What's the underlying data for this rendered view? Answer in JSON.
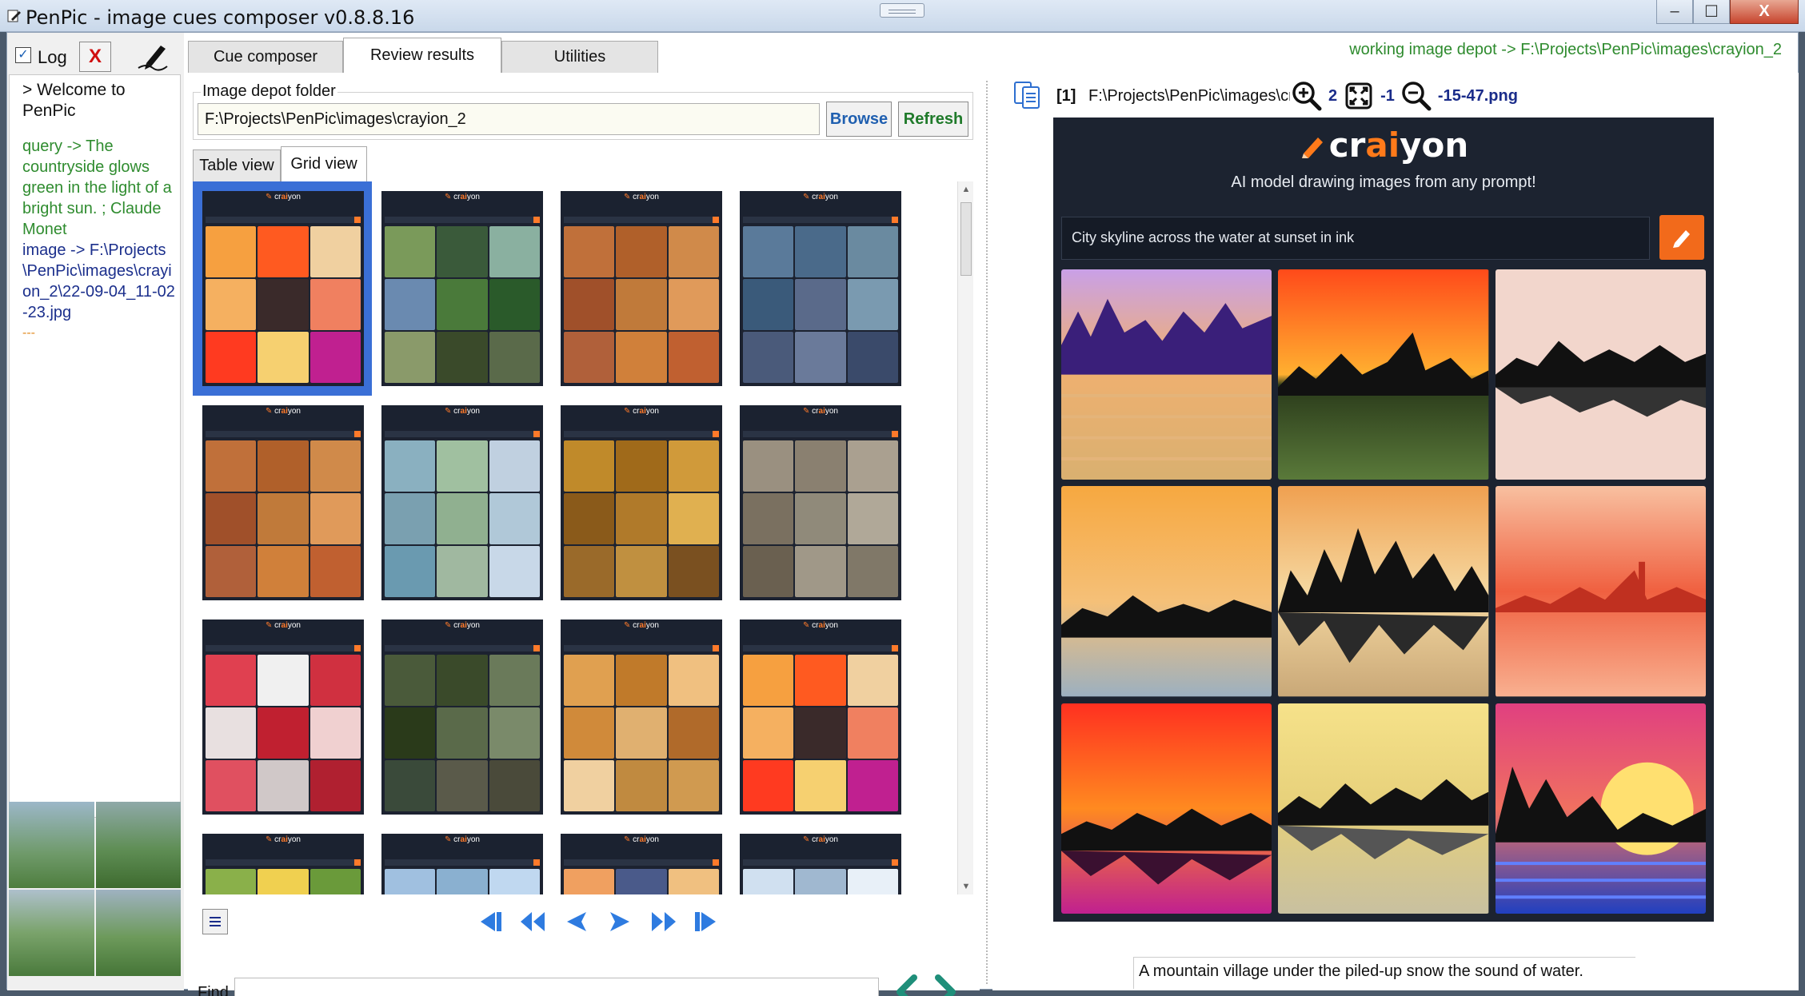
{
  "window": {
    "title": "PenPic - image cues composer v0.8.8.16",
    "controls": [
      "–",
      "☐",
      "X"
    ]
  },
  "left_panel": {
    "log_checked": true,
    "log_label": "Log",
    "clear_label": "X",
    "log_lines": {
      "welcome": "> Welcome to PenPic",
      "query": "query -> The countryside glows green in the light of a bright sun. ; Claude Monet",
      "image": "image -> F:\\Projects\\PenPic\\images\\crayion_2\\22-09-04_11-02-23.jpg",
      "separator": "---"
    }
  },
  "tabs": [
    {
      "label": "Cue composer",
      "active": false
    },
    {
      "label": "Review results",
      "active": true
    },
    {
      "label": "Utilities",
      "active": false
    }
  ],
  "depot_banner": "working image depot -> F:\\Projects\\PenPic\\images\\crayion_2",
  "depot": {
    "group_label": "Image depot folder",
    "path": "F:\\Projects\\PenPic\\images\\crayion_2",
    "browse_label": "Browse",
    "refresh_label": "Refresh"
  },
  "view_tabs": [
    {
      "label": "Table view",
      "active": false
    },
    {
      "label": "Grid view",
      "active": true
    }
  ],
  "grid_thumbs": [
    {
      "theme": "skyline",
      "selected": true
    },
    {
      "theme": "waterfall"
    },
    {
      "theme": "gingerbread"
    },
    {
      "theme": "castle"
    },
    {
      "theme": "gingerbread"
    },
    {
      "theme": "watercolor-waterfall"
    },
    {
      "theme": "autumn-forest"
    },
    {
      "theme": "foggy-street"
    },
    {
      "theme": "diner"
    },
    {
      "theme": "forest-cabin"
    },
    {
      "theme": "autumn-leaves"
    },
    {
      "theme": "skyline"
    },
    {
      "theme": "meadow"
    },
    {
      "theme": "mountains"
    },
    {
      "theme": "sunset-mountains"
    },
    {
      "theme": "snow-mountains"
    }
  ],
  "find": {
    "label": "Find",
    "value": ""
  },
  "viewer": {
    "index": "[1]",
    "path": "F:\\Projects\\PenPic\\images\\crayio",
    "path_tail": "-15-47.png",
    "path_mid_a": "2",
    "path_mid_b": "-1",
    "zoom_icons": [
      "zoom-in-icon",
      "fit-screen-icon",
      "zoom-out-icon"
    ],
    "craiyon": {
      "logo_pre": "cr",
      "logo_ai": "ai",
      "logo_post": "yon",
      "tagline": "AI model drawing images from any prompt!",
      "prompt": "City skyline across the water at sunset in ink"
    },
    "caption": "A mountain village under the piled-up snow the sound of water."
  },
  "colors": {
    "accent_orange": "#f26a1b",
    "selection_blue": "#3a6fd6",
    "green_text": "#2e8b2e",
    "navy_text": "#1a2c8a"
  }
}
